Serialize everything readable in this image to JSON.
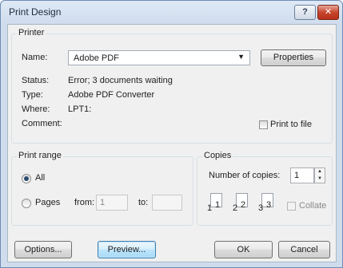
{
  "window": {
    "title": "Print Design",
    "help_label": "?",
    "close_label": "✕"
  },
  "printer": {
    "group_title": "Printer",
    "name_label": "Name:",
    "name_value": "Adobe PDF",
    "properties_label": "Properties",
    "status_label": "Status:",
    "status_value": "Error; 3 documents waiting",
    "type_label": "Type:",
    "type_value": "Adobe PDF Converter",
    "where_label": "Where:",
    "where_value": "LPT1:",
    "comment_label": "Comment:",
    "print_to_file_label": "Print to file"
  },
  "print_range": {
    "group_title": "Print range",
    "all_label": "All",
    "pages_label": "Pages",
    "from_label": "from:",
    "from_value": "1",
    "to_label": "to:",
    "to_value": "",
    "selected": "All"
  },
  "copies": {
    "group_title": "Copies",
    "number_label": "Number of copies:",
    "number_value": "1",
    "collate_label": "Collate",
    "page_numbers": [
      "1",
      "1",
      "2",
      "2",
      "3",
      "3"
    ]
  },
  "buttons": {
    "options": "Options...",
    "preview": "Preview...",
    "ok": "OK",
    "cancel": "Cancel"
  }
}
